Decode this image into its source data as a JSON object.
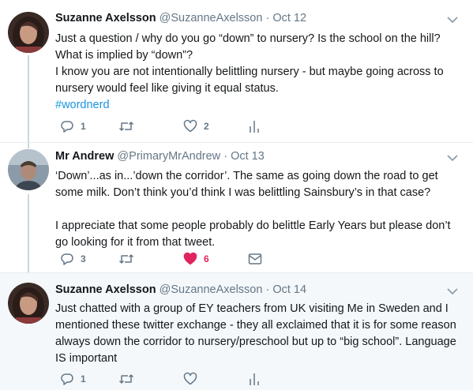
{
  "tweets": [
    {
      "display_name": "Suzanne Axelsson",
      "handle": "@SuzanneAxelsson",
      "separator": "·",
      "timestamp": "Oct 12",
      "text_lines": [
        "Just a question / why do you go “down” to nursery? Is the school on the hill?",
        "What is implied by “down”?",
        "I know you are not intentionally belittling nursery - but maybe going across to",
        "nursery would feel like giving it equal status."
      ],
      "hashtag": "#wordnerd",
      "replies": "1",
      "retweets": "",
      "likes": "2",
      "liked": false,
      "last_icon": "analytics-icon"
    },
    {
      "display_name": "Mr Andrew",
      "handle": "@PrimaryMrAndrew",
      "separator": "·",
      "timestamp": "Oct 13",
      "text_lines": [
        "‘Down’...as in...’down the corridor’. The same as going down the road to get",
        "some milk. Don’t think you’d think I was belittling Sainsbury’s in that case?",
        "",
        "I appreciate that some people probably do belittle Early Years but please don’t",
        "go looking for it from that tweet."
      ],
      "replies": "3",
      "retweets": "",
      "likes": "6",
      "liked": true,
      "last_icon": "direct-message-icon"
    },
    {
      "display_name": "Suzanne Axelsson",
      "handle": "@SuzanneAxelsson",
      "separator": "·",
      "timestamp": "Oct 14",
      "text_lines": [
        "Just chatted with a group of EY teachers from UK visiting Me in Sweden and I",
        "mentioned these twitter exchange - they all exclaimed that it is for some reason",
        "always down the corridor to nursery/preschool but up to “big school”. Language",
        "IS important"
      ],
      "replies": "1",
      "retweets": "",
      "likes": "",
      "liked": false,
      "last_icon": "analytics-icon"
    }
  ],
  "colors": {
    "text": "#14171a",
    "secondary": "#657786",
    "link": "#1b95e0",
    "like_active": "#e0245e",
    "thread_line": "#ccd6dd",
    "highlight_bg": "#f5f8fa"
  }
}
